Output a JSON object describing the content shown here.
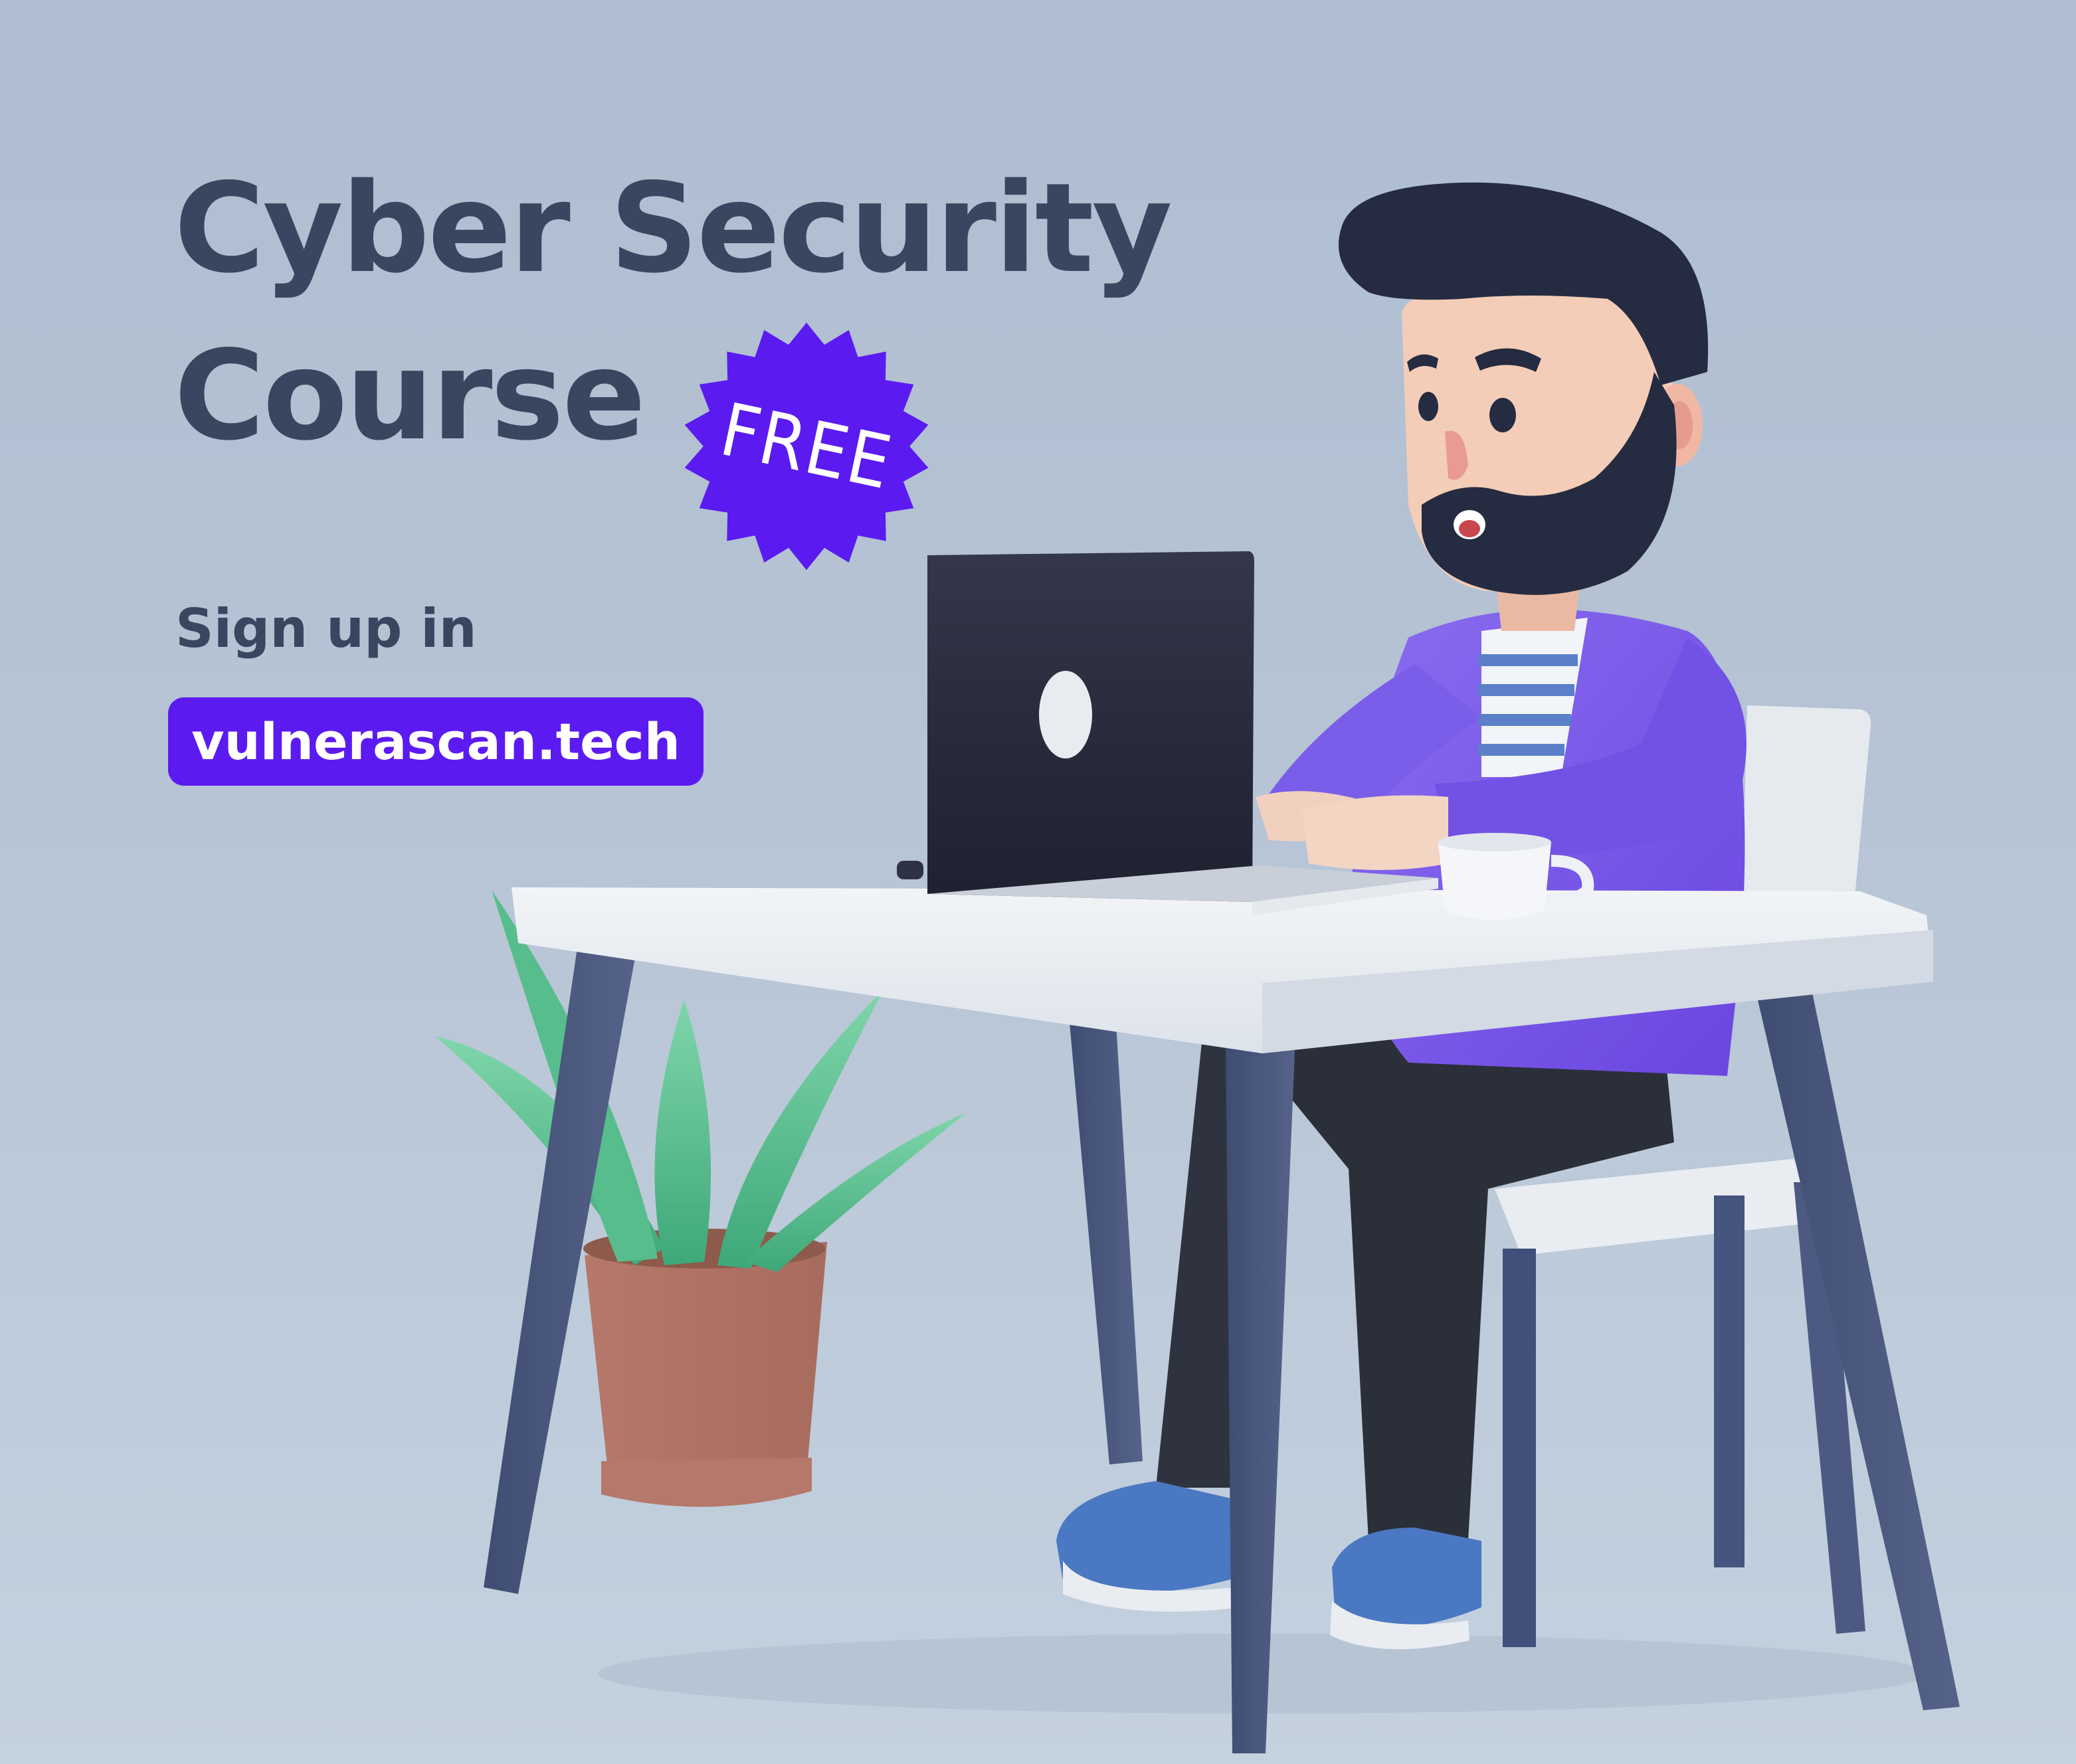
{
  "headline": {
    "line1": "Cyber Security",
    "line2": "Course"
  },
  "badge": {
    "label": "FREE",
    "color": "#5b1bf0"
  },
  "signup": {
    "label": "Sign up in",
    "url": "vulnerascan.tech"
  },
  "colors": {
    "background": "#b6c4d5",
    "heading": "#3a4560",
    "accent": "#5b1bf0"
  },
  "illustration": {
    "subject": "3D man typing on laptop at desk",
    "objects": [
      "man",
      "laptop",
      "desk",
      "chair",
      "coffee-cup",
      "potted-plant"
    ]
  }
}
